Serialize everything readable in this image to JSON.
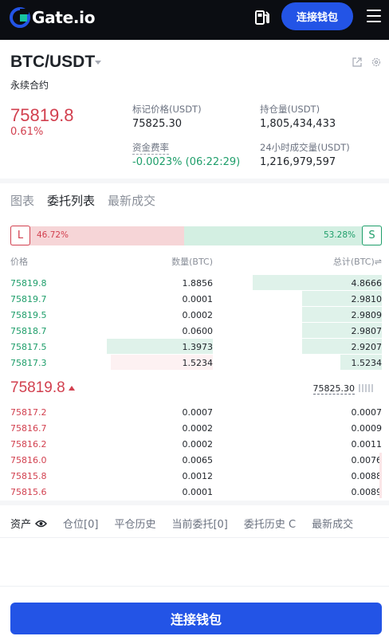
{
  "header": {
    "logo_text": "Gate.io",
    "connect_wallet_label": "连接钱包",
    "colors": {
      "bar": "#0b0d12",
      "accent": "#2354e6"
    }
  },
  "market": {
    "pair": "BTC/USDT",
    "contract_type": "永续合约",
    "last_price": "75819.8",
    "change_pct": "0.61%",
    "stats": {
      "mark_price_label": "标记价格(USDT)",
      "mark_price": "75825.30",
      "open_interest_label": "持仓量(USDT)",
      "open_interest": "1,805,434,433",
      "funding_label": "资金费率",
      "funding": "-0.0023% (06:22:29)",
      "volume_label": "24小时成交量(USDT)",
      "volume": "1,216,979,597"
    }
  },
  "tabs": [
    "图表",
    "委托列表",
    "最新成交"
  ],
  "ratio": {
    "long_label": "L",
    "short_label": "S",
    "long_pct": "46.72%",
    "short_pct": "53.28%",
    "long_fraction": 0.4672
  },
  "orderbook": {
    "headers": {
      "price": "价格",
      "qty": "数量(BTC)",
      "total": "总计(BTC)⇌"
    },
    "asks": [
      {
        "price": "75819.8",
        "qty": "1.8856",
        "total": "4.8666",
        "depth": 0.34
      },
      {
        "price": "75819.7",
        "qty": "0.0001",
        "total": "2.9810",
        "depth": 0.21
      },
      {
        "price": "75819.5",
        "qty": "0.0002",
        "total": "2.9809",
        "depth": 0.21
      },
      {
        "price": "75818.7",
        "qty": "0.0600",
        "total": "2.9807",
        "depth": 0.21
      },
      {
        "price": "75817.5",
        "qty": "1.3973",
        "total": "2.9207",
        "depth": 0.21,
        "qty_depth": 0.28
      },
      {
        "price": "75817.3",
        "qty": "1.5234",
        "total": "1.5234",
        "depth": 0.11,
        "qty_depth": 0.28
      }
    ],
    "mid_price": "75819.8",
    "mid_mark": "75825.30",
    "bids": [
      {
        "price": "75817.2",
        "qty": "0.0007",
        "total": "0.0007"
      },
      {
        "price": "75816.7",
        "qty": "0.0002",
        "total": "0.0009"
      },
      {
        "price": "75816.2",
        "qty": "0.0002",
        "total": "0.0011"
      },
      {
        "price": "75816.0",
        "qty": "0.0065",
        "total": "0.0076"
      },
      {
        "price": "75815.8",
        "qty": "0.0012",
        "total": "0.0088"
      },
      {
        "price": "75815.6",
        "qty": "0.0001",
        "total": "0.0089"
      }
    ],
    "colors": {
      "ask": "#1e9e6a",
      "bid": "#d2404f"
    }
  },
  "bottom_tabs": [
    "资产",
    "仓位[0]",
    "平仓历史",
    "当前委托[0]",
    "委托历史 C",
    "最新成交"
  ],
  "footer": {
    "connect_wallet_label": "连接钱包"
  },
  "icons": [
    "logo-mark-icon",
    "fuel-station-icon",
    "menu-icon",
    "caret-down-icon",
    "external-link-icon",
    "settings-icon",
    "eye-icon",
    "arrow-up-icon"
  ]
}
